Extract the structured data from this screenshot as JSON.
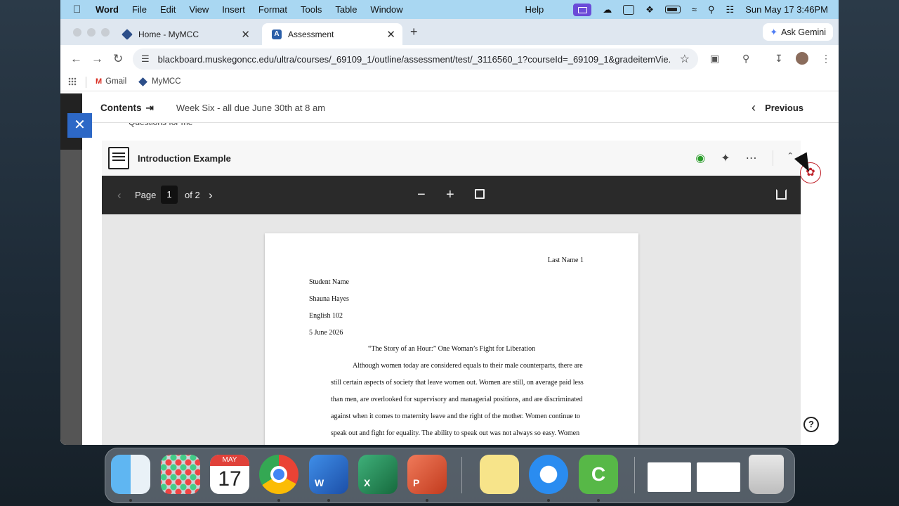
{
  "menubar": {
    "app": "Word",
    "items": [
      "File",
      "Edit",
      "View",
      "Insert",
      "Format",
      "Tools",
      "Table",
      "Window"
    ],
    "help": "Help",
    "clock": "Sun May 17  3:46PM"
  },
  "browser": {
    "tabs": [
      {
        "label": "Home - MyMCC",
        "active": false
      },
      {
        "label": "Assessment",
        "active": true
      }
    ],
    "gemini_label": "Ask Gemini",
    "url": "blackboard.muskegoncc.edu/ultra/courses/_69109_1/outline/assessment/test/_3116560_1?courseId=_69109_1&gradeitemVie...",
    "bookmarks": [
      "Gmail",
      "MyMCC"
    ]
  },
  "course": {
    "contents_label": "Contents",
    "week_label": "Week Six - all due June 30th at 8 am",
    "previous_label": "Previous",
    "peek_text": "Questions for me"
  },
  "document": {
    "title": "Introduction Example",
    "viewer": {
      "page_label": "Page",
      "current_page": "1",
      "of_label": "of 2"
    },
    "paper": {
      "header": "Last Name 1",
      "meta": [
        "Student Name",
        "Shauna Hayes",
        "English 102",
        "5 June 2026"
      ],
      "essay_title": "“The Story of an Hour:” One Woman’s Fight for Liberation",
      "lines": [
        "Although women today are considered equals to their male counterparts, there are",
        "still certain aspects of society that leave women out. Women are still, on average paid less",
        "than men, are overlooked for supervisory and managerial positions, and are discriminated",
        "against when it comes to maternity leave and the right of the mother. Women continue to",
        "speak out and fight for equality. The ability to speak out was not always so easy. Women"
      ]
    }
  },
  "dock": {
    "calendar_month": "MAY",
    "calendar_day": "17",
    "word_letter": "W",
    "excel_letter": "X",
    "ppt_letter": "P",
    "camtasia_letter": "C"
  }
}
